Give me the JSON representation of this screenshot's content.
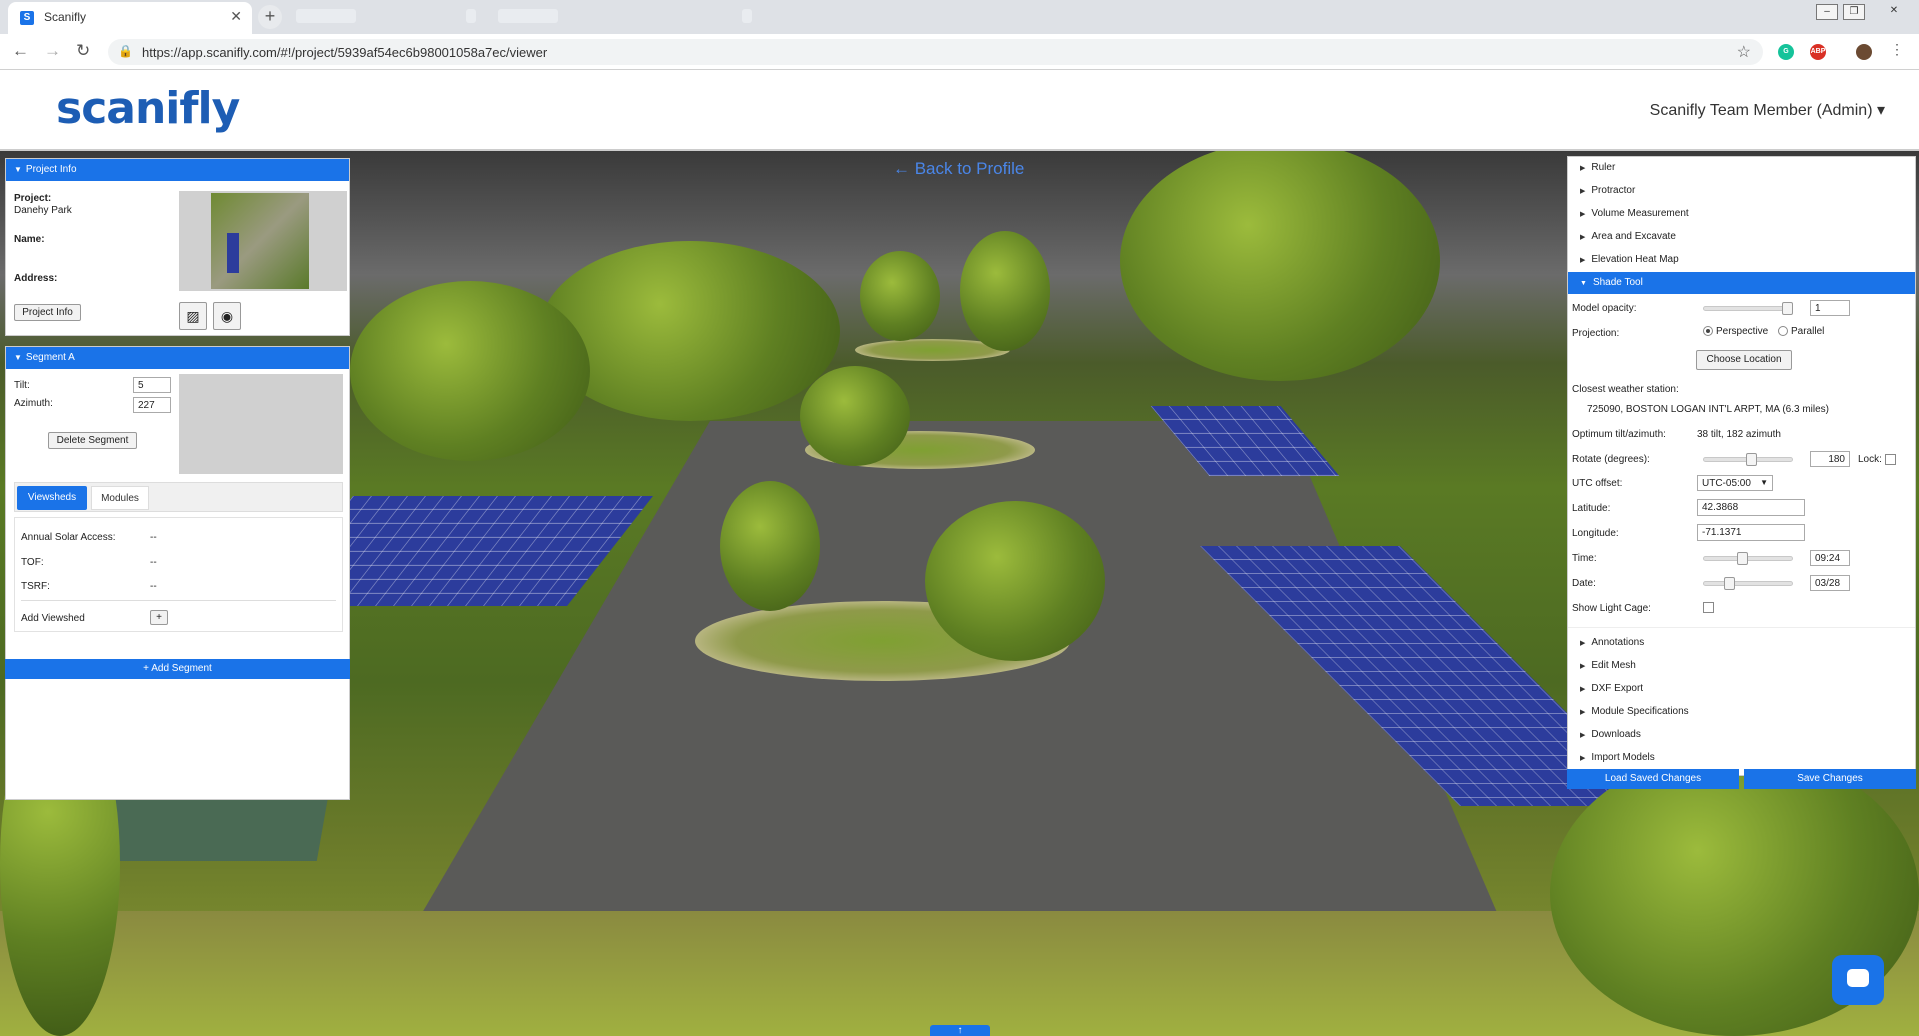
{
  "browser": {
    "tab_title": "Scanifly",
    "tab_close": "✕",
    "favicon_letter": "S",
    "url": "https://app.scanifly.com/#!/project/5939af54ec6b98001058a7ec/viewer"
  },
  "header": {
    "logo": "scanifly",
    "user": "Scanifly Team Member (Admin) ▾"
  },
  "viewer": {
    "back_link": "← Back to Profile"
  },
  "project_info": {
    "title": "Project Info",
    "project_label": "Project:",
    "project_value": "Danehy Park",
    "name_label": "Name:",
    "address_label": "Address:",
    "button": "Project Info"
  },
  "segment": {
    "title": "Segment A",
    "tilt_label": "Tilt:",
    "tilt_value": "5",
    "azimuth_label": "Azimuth:",
    "azimuth_value": "227",
    "delete_button": "Delete Segment",
    "tabs": [
      "Viewsheds",
      "Modules"
    ],
    "rows": [
      {
        "label": "Annual Solar Access:",
        "value": "--"
      },
      {
        "label": "TOF:",
        "value": "--"
      },
      {
        "label": "TSRF:",
        "value": "--"
      }
    ],
    "add_viewshed_label": "Add Viewshed",
    "add_viewshed_btn": "+",
    "add_segment": "+ Add Segment"
  },
  "tools": {
    "top_items": [
      "Ruler",
      "Protractor",
      "Volume Measurement",
      "Area and Excavate",
      "Elevation Heat Map"
    ],
    "active": "Shade Tool",
    "bottom_items": [
      "Annotations",
      "Edit Mesh",
      "DXF Export",
      "Module Specifications",
      "Downloads",
      "Import Models"
    ]
  },
  "shade": {
    "opacity_label": "Model opacity:",
    "opacity_value": "1",
    "projection_label": "Projection:",
    "perspective": "Perspective",
    "parallel": "Parallel",
    "choose_location": "Choose Location",
    "weather_label": "Closest weather station:",
    "weather_value": "725090, BOSTON LOGAN INT'L ARPT, MA (6.3 miles)",
    "optimum_label": "Optimum tilt/azimuth:",
    "optimum_value": "38 tilt, 182 azimuth",
    "rotate_label": "Rotate (degrees):",
    "rotate_value": "180",
    "lock_label": "Lock:",
    "utc_label": "UTC offset:",
    "utc_value": "UTC-05:00",
    "latitude_label": "Latitude:",
    "latitude_value": "42.3868",
    "longitude_label": "Longitude:",
    "longitude_value": "-71.1371",
    "time_label": "Time:",
    "time_value": "09:24",
    "date_label": "Date:",
    "date_value": "03/28",
    "light_cage_label": "Show Light Cage:"
  },
  "actions": {
    "load": "Load Saved Changes",
    "save": "Save Changes"
  },
  "colors": {
    "accent": "#1a73e8",
    "logo": "#1d5db4"
  }
}
